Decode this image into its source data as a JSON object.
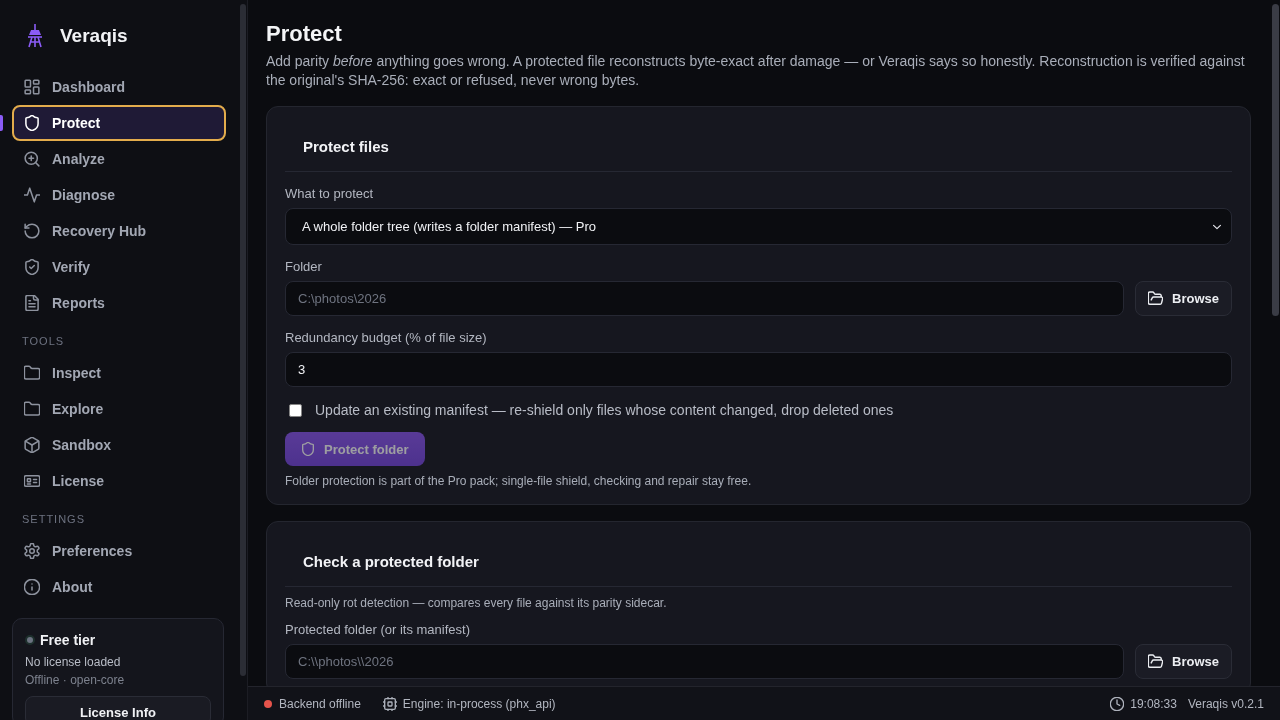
{
  "sidebar": {
    "brand": "Veraqis",
    "sections": [
      {
        "items": [
          {
            "label": "Dashboard",
            "selected": false
          },
          {
            "label": "Protect",
            "selected": true
          },
          {
            "label": "Analyze",
            "selected": false
          },
          {
            "label": "Diagnose",
            "selected": false
          },
          {
            "label": "Recovery Hub",
            "selected": false
          },
          {
            "label": "Verify",
            "selected": false
          },
          {
            "label": "Reports",
            "selected": false
          }
        ]
      },
      {
        "heading": "TOOLS",
        "items": [
          {
            "label": "Inspect",
            "selected": false
          },
          {
            "label": "Explore",
            "selected": false
          },
          {
            "label": "Sandbox",
            "selected": false
          },
          {
            "label": "License",
            "selected": false
          }
        ]
      },
      {
        "heading": "SETTINGS",
        "items": [
          {
            "label": "Preferences",
            "selected": false
          },
          {
            "label": "About",
            "selected": false
          }
        ]
      }
    ],
    "license_card": {
      "title": "Free tier",
      "licensed": false,
      "status": "No license loaded",
      "detail": "Offline · open-core",
      "button": "License Info"
    }
  },
  "page": {
    "title": "Protect",
    "description": "Add parity *before* anything goes wrong. A protected file reconstructs byte-exact after damage — or Veraqis says so honestly. Reconstruction is verified against the original's SHA-256: exact or refused, never wrong bytes."
  },
  "cards": [
    {
      "title": "Protect files",
      "fields": [
        {
          "kind": "select",
          "label": "What to protect",
          "value": "A whole folder tree (writes a folder manifest) — Pro"
        },
        {
          "kind": "path",
          "label": "Folder",
          "placeholder": "C:\\photos\\2026",
          "button": "Browse"
        },
        {
          "kind": "text",
          "label": "Redundancy budget (% of file size)",
          "value": "3"
        },
        {
          "kind": "checkbox",
          "label": "Update an existing manifest — re-shield only files whose content changed, drop deleted ones",
          "checked": false
        },
        {
          "kind": "action",
          "label": "Protect folder",
          "disabled": true
        },
        {
          "kind": "note",
          "text": "Folder protection is part of the Pro pack; single-file shield, checking and repair stay free."
        }
      ]
    },
    {
      "title": "Check a protected folder",
      "fields": [
        {
          "kind": "note",
          "text": "Read-only rot detection — compares every file against its parity sidecar."
        },
        {
          "kind": "path",
          "label": "Protected folder (or its manifest)",
          "placeholder": "C:\\\\photos\\\\2026",
          "button": "Browse"
        }
      ]
    }
  ],
  "status_bar": {
    "backend": {
      "label": "Backend offline",
      "online": false
    },
    "engine": "Engine: in-process (phx_api)",
    "time": "19:08:33",
    "version": "Veraqis v0.2.1"
  }
}
